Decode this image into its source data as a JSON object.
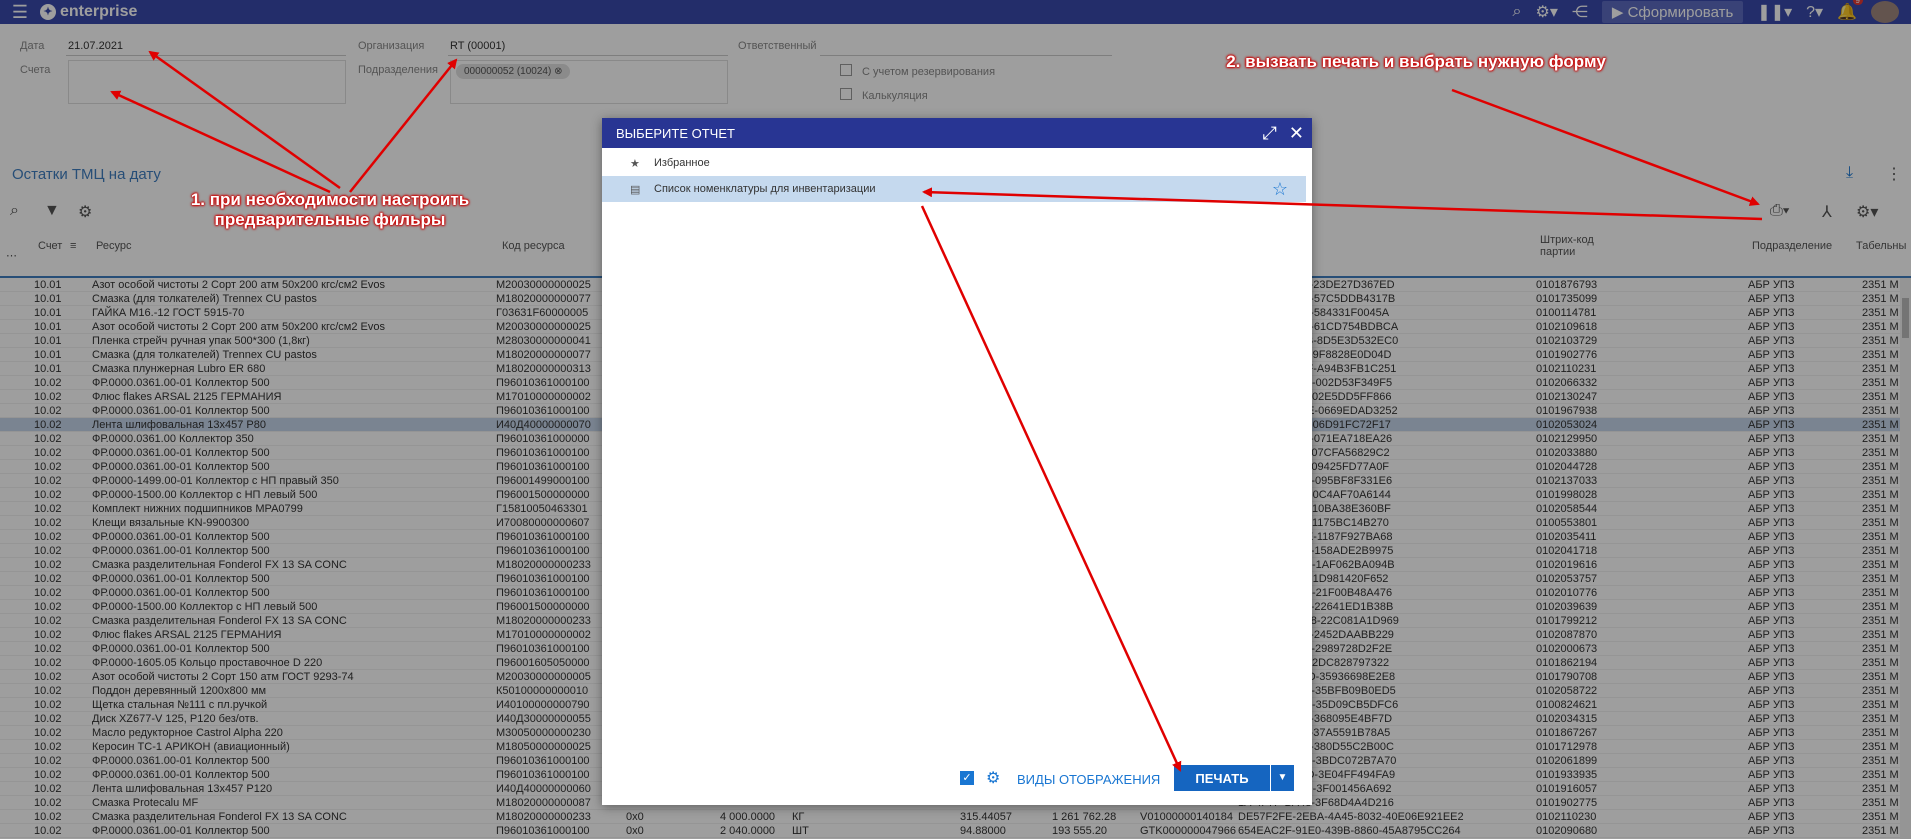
{
  "app": {
    "name": "enterprise",
    "form_button": "Сформировать",
    "notif_count": "9"
  },
  "filters": {
    "date_label": "Дата",
    "date_value": "21.07.2021",
    "accounts_label": "Счета",
    "org_label": "Организация",
    "org_value": "RT (00001)",
    "dept_label": "Подразделения",
    "dept_chip": "000000052 (10024)",
    "responsible_label": "Ответственный",
    "reserve_label": "С учетом резервирования",
    "calc_label": "Калькуляция"
  },
  "section": {
    "title": "Остатки ТМЦ на дату"
  },
  "table": {
    "headers": {
      "account": "Счет",
      "resource": "Ресурс",
      "code": "Код ресурса",
      "barcode": "Штрих-код партии",
      "dept": "Подразделение",
      "tab": "Табельны"
    },
    "rows": [
      {
        "acc": "10.01",
        "res": "Азот особой чистоты 2 Сорт 200 атм 50х200 кгс/см2 Evos",
        "code": "М20030000000025",
        "bc": "8E-4424-8C31-23DE27D367ED",
        "p": "0101876793",
        "d": "АБР УПЗ",
        "t": "2351 М"
      },
      {
        "acc": "10.01",
        "res": " Смазка (для толкателей) Trennex CU pastos",
        "code": "М18020000000077",
        "bc": "A0-421A-99B1-57C5DDB4317B",
        "p": "0101735099",
        "d": "АБР УПЗ",
        "t": "2351 М"
      },
      {
        "acc": "10.01",
        "res": "ГАЙКА М16.-12 ГОСТ 5915-70",
        "code": "Г03631F60000005",
        "bc": "07-423D-8D63-584331F0045A",
        "p": "0100114781",
        "d": "АБР УПЗ",
        "t": "2351 М"
      },
      {
        "acc": "10.01",
        "res": "Азот особой чистоты 2 Сорт 200 атм 50х200 кгс/см2 Evos",
        "code": "М20030000000025",
        "bc": "73-4EB7-A862-61CD754BDBCA",
        "p": "0102109618",
        "d": "АБР УПЗ",
        "t": "2351 М"
      },
      {
        "acc": "10.01",
        "res": "Пленка стрейч ручная упак 500*300 (1,8кг)",
        "code": "М28030000000041",
        "bc": "33-4DBA-8A4B-8D5E3D532EC0",
        "p": "0102103729",
        "d": "АБР УПЗ",
        "t": "2351 М"
      },
      {
        "acc": "10.01",
        "res": " Смазка (для толкателей) Trennex CU pastos",
        "code": "М18020000000077",
        "bc": "74-47A7-985B-9F8828E0D04D",
        "p": "0101902776",
        "d": "АБР УПЗ",
        "t": "2351 М"
      },
      {
        "acc": "10.01",
        "res": "Смазка плунжерная Lubro ER 680",
        "code": "М18020000000313",
        "bc": "AE-4054-ABEF-A94B3FB1C251",
        "p": "0102110231",
        "d": "АБР УПЗ",
        "t": "2351 М"
      },
      {
        "acc": "10.02",
        "res": "ФР.0000.0361.00-01 Коллектор 500",
        "code": "П96010361000100",
        "bc": "19-4BE8-AFE7-002D53F349F5",
        "p": "0102066332",
        "d": "АБР УПЗ",
        "t": "2351 М"
      },
      {
        "acc": "10.02",
        "res": " Флюс flakes ARSAL 2125 ГЕРМАНИЯ",
        "code": "М17010000000002",
        "bc": "54-423F-B135-02E5DD5FF866",
        "p": "0102130247",
        "d": "АБР УПЗ",
        "t": "2351 М"
      },
      {
        "acc": "10.02",
        "res": "ФР.0000.0361.00-01 Коллектор 500",
        "code": "П96010361000100",
        "bc": "2B-46FF-ABDE-0669EDAD3252",
        "p": "0101967938",
        "d": "АБР УПЗ",
        "t": "2351 М"
      },
      {
        "acc": "10.02",
        "res": "Лента шлифовальная 13х457 Р80",
        "code": "И40Д40000000070",
        "bc": "22-49A8-A786-06D91FC72F17",
        "p": "0102053024",
        "d": "АБР УПЗ",
        "t": "2351 М",
        "sel": true
      },
      {
        "acc": "10.02",
        "res": "ФР.0000.0361.00 Коллектор 350",
        "code": "П96010361000000",
        "bc": "06-45AB-A438-071EA718EA26",
        "p": "0102129950",
        "d": "АБР УПЗ",
        "t": "2351 М"
      },
      {
        "acc": "10.02",
        "res": "ФР.0000.0361.00-01 Коллектор 500",
        "code": "П96010361000100",
        "bc": "81-4022-A268-07CFA56829C2",
        "p": "0102033880",
        "d": "АБР УПЗ",
        "t": "2351 М"
      },
      {
        "acc": "10.02",
        "res": "ФР.0000.0361.00-01 Коллектор 500",
        "code": "П96010361000100",
        "bc": "59-4837-9F1F-09425FD77A0F",
        "p": "0102044728",
        "d": "АБР УПЗ",
        "t": "2351 М"
      },
      {
        "acc": "10.02",
        "res": "ФР.0000-1499.00-01 Коллектор с НП правый 350",
        "code": "П96001499000100",
        "bc": "B5-4AA3-B961-095BF8F331E6",
        "p": "0102137033",
        "d": "АБР УПЗ",
        "t": "2351 М"
      },
      {
        "acc": "10.02",
        "res": "ФР.0000-1500.00 Коллектор с НП левый 500",
        "code": "П96001500000000",
        "bc": "35-414A-83B5-0C4AF70A6144",
        "p": "0101998028",
        "d": "АБР УПЗ",
        "t": "2351 М"
      },
      {
        "acc": "10.02",
        "res": "Комплект нижних подшипников МРА0799",
        "code": "Г15810050463301",
        "bc": "46-4B83-94F4-10BA38E360BF",
        "p": "0102058544",
        "d": "АБР УПЗ",
        "t": "2351 М"
      },
      {
        "acc": "10.02",
        "res": "Клещи вязальные KN-9900300",
        "code": "И70080000000607",
        "bc": "4C-4728-8334-1175BC14B270",
        "p": "0100553801",
        "d": "АБР УПЗ",
        "t": "2351 М"
      },
      {
        "acc": "10.02",
        "res": "ФР.0000.0361.00-01 Коллектор 500",
        "code": "П96010361000100",
        "bc": "B5-45D5-BB6E-1187F927BA68",
        "p": "0102035411",
        "d": "АБР УПЗ",
        "t": "2351 М"
      },
      {
        "acc": "10.02",
        "res": "ФР.0000.0361.00-01 Коллектор 500",
        "code": "П96010361000100",
        "bc": "E5-41E6-97D6-158ADE2B9975",
        "p": "0102041718",
        "d": "АБР УПЗ",
        "t": "2351 М"
      },
      {
        "acc": "10.02",
        "res": "Смазка разделительная Fonderol FX 13 SA CONC",
        "code": "М18020000000233",
        "bc": "27-4EA6-B37C-1AF062BA094B",
        "p": "0102019616",
        "d": "АБР УПЗ",
        "t": "2351 М"
      },
      {
        "acc": "10.02",
        "res": "ФР.0000.0361.00-01 Коллектор 500",
        "code": "П96010361000100",
        "bc": "F8-420B-8F09-1D981420F652",
        "p": "0102053757",
        "d": "АБР УПЗ",
        "t": "2351 М"
      },
      {
        "acc": "10.02",
        "res": "ФР.0000.0361.00-01 Коллектор 500",
        "code": "П96010361000100",
        "bc": "57-42BC-B18B-21F00B48A476",
        "p": "0102010776",
        "d": "АБР УПЗ",
        "t": "2351 М"
      },
      {
        "acc": "10.02",
        "res": "ФР.0000-1500.00 Коллектор с НП левый 500",
        "code": "П96001500000000",
        "bc": "A5-48F4-B3B4-22641ED1B38B",
        "p": "0102039639",
        "d": "АБР УПЗ",
        "t": "2351 М"
      },
      {
        "acc": "10.02",
        "res": "Смазка разделительная Fonderol FX 13 SA CONC",
        "code": "М18020000000233",
        "bc": "5A-4BCC-AED8-22C081A1D969",
        "p": "0101799212",
        "d": "АБР УПЗ",
        "t": "2351 М"
      },
      {
        "acc": "10.02",
        "res": " Флюс flakes ARSAL 2125 ГЕРМАНИЯ",
        "code": "М17010000000002",
        "bc": "FD-453B-9057-2452DAABB229",
        "p": "0102087870",
        "d": "АБР УПЗ",
        "t": "2351 М"
      },
      {
        "acc": "10.02",
        "res": "ФР.0000.0361.00-01 Коллектор 500",
        "code": "П96010361000100",
        "bc": "E1-48A6-B4B3-2989728D2F2E",
        "p": "0102000673",
        "d": "АБР УПЗ",
        "t": "2351 М"
      },
      {
        "acc": "10.02",
        "res": "ФР.0000-1605.05 Кольцо проставочное D 220",
        "code": "П96001605050000",
        "bc": "7C-4817-8685-2DC828797322",
        "p": "0101862194",
        "d": "АБР УПЗ",
        "t": "2351 М"
      },
      {
        "acc": "10.02",
        "res": "Азот особой чистоты 2 Сорт 150 атм ГОСТ 9293-74",
        "code": "М20030000000005",
        "bc": "0C-4AAC-8B3D-35936698E2E8",
        "p": "0101790708",
        "d": "АБР УПЗ",
        "t": "2351 М"
      },
      {
        "acc": "10.02",
        "res": "Поддон деревянный 1200х800 мм",
        "code": "К50100000000010",
        "bc": "7C-448F-8B8E-35BFB09B0ED5",
        "p": "0102058722",
        "d": "АБР УПЗ",
        "t": "2351 М"
      },
      {
        "acc": "10.02",
        "res": "Щетка стальная №111 с пл.ручкой",
        "code": "И40100000000790",
        "bc": "66-49DC-93D0-35D09CB5DFC6",
        "p": "0100824621",
        "d": "АБР УПЗ",
        "t": "2351 М"
      },
      {
        "acc": "10.02",
        "res": "Диск XZ677-V  125, Р120 без/отв.",
        "code": "И40Д30000000055",
        "bc": "22-4E4E-B720-368095E4BF7D",
        "p": "0102034315",
        "d": "АБР УПЗ",
        "t": "2351 М"
      },
      {
        "acc": "10.02",
        "res": "Масло редукторное Castrol Alpha 220",
        "code": "М30050000000230",
        "bc": "7D-4660-8B59-37A5591B78A5",
        "p": "0101867267",
        "d": "АБР УПЗ",
        "t": "2351 М"
      },
      {
        "acc": "10.02",
        "res": "Керосин ТС-1 АРИКОН (авиационный)",
        "code": "М18050000000025",
        "bc": "58-4CE2-810F-380D55C2B00C",
        "p": "0101712978",
        "d": "АБР УПЗ",
        "t": "2351 М"
      },
      {
        "acc": "10.02",
        "res": "ФР.0000.0361.00-01 Коллектор 500",
        "code": "П96010361000100",
        "bc": "43-4CAC-9F98-3BDC072B7A70",
        "p": "0102061899",
        "d": "АБР УПЗ",
        "t": "2351 М"
      },
      {
        "acc": "10.02",
        "res": "ФР.0000.0361.00-01 Коллектор 500",
        "code": "П96010361000100",
        "bc": "7F-4CD3-86CD-3E04FF494FA9",
        "p": "0101933935",
        "d": "АБР УПЗ",
        "t": "2351 М"
      },
      {
        "acc": "10.02",
        "res": "Лента шлифовальная 13х457 Р120",
        "code": "И40Д40000000060",
        "bc": "7B-41EC-B5F9-3F001456A692",
        "p": "0101916057",
        "d": "АБР УПЗ",
        "t": "2351 М"
      },
      {
        "acc": "10.02",
        "res": " Смазка Protecalu MF",
        "code": "М18020000000087",
        "bc": "1A-4F7F-BA48-3F68D4A4D216",
        "p": "0101902775",
        "d": "АБР УПЗ",
        "t": "2351 М"
      },
      {
        "acc": "10.02",
        "res": "Смазка разделительная Fonderol FX 13 SA CONC",
        "code": "М18020000000233",
        "x": "0x0",
        "q": "4 000.0000",
        "u": "КГ",
        "v1": "315.44057",
        "v2": "1 261 762.28",
        "g": "V01000000140184",
        "bc": "DE57F2FE-2EBA-4A45-8032-40E06E921EE2",
        "p": "0102110230",
        "d": "АБР УПЗ",
        "t": "2351 М"
      },
      {
        "acc": "10.02",
        "res": "ФР.0000.0361.00-01 Коллектор 500",
        "code": "П96010361000100",
        "x": "0x0",
        "q": "2 040.0000",
        "u": "ШТ",
        "v1": "94.88000",
        "v2": "193 555.20",
        "g": "GTK000000047966",
        "bc": "654EAC2F-91E0-439B-8860-45A8795CC264",
        "p": "0102090680",
        "d": "АБР УПЗ",
        "t": "2351 М"
      }
    ]
  },
  "dialog": {
    "title": "ВЫБЕРИТЕ ОТЧЕТ",
    "favorites": "Избранное",
    "report_item": "Список номенклатуры для инвентаризации",
    "views_label": "ВИДЫ ОТОБРАЖЕНИЯ",
    "print_label": "ПЕЧАТЬ"
  },
  "annotations": {
    "step1_line1": "1. при необходимости настроить",
    "step1_line2": "предварительные фильры",
    "step2": "2. вызвать печать и выбрать нужную форму"
  },
  "colors": {
    "topbar": "#3949ab",
    "dialog_header": "#283593",
    "accent": "#1565c0",
    "arrow": "#e00000"
  }
}
